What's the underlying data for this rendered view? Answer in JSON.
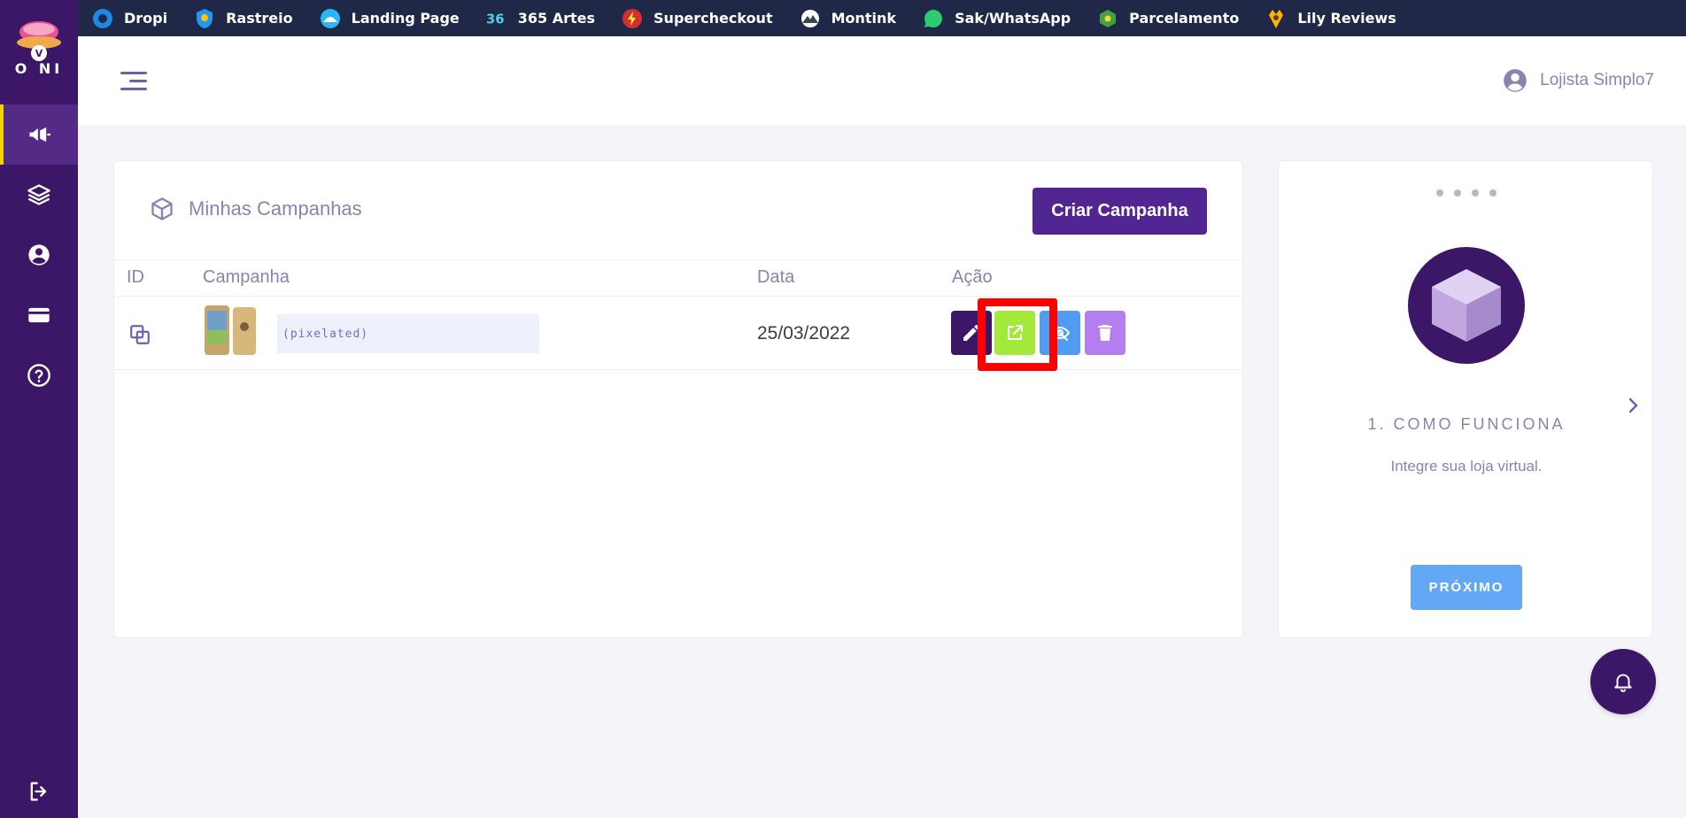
{
  "brand": {
    "logo_text": "O NI",
    "accent": "#3d1767",
    "indicator": "#f2d300"
  },
  "sidebar": {
    "items": [
      {
        "name": "campaigns",
        "icon": "megaphone-icon",
        "active": true
      },
      {
        "name": "layers",
        "icon": "layers-icon",
        "active": false
      },
      {
        "name": "account",
        "icon": "user-circle-icon",
        "active": false
      },
      {
        "name": "billing",
        "icon": "credit-card-icon",
        "active": false
      },
      {
        "name": "help",
        "icon": "help-circle-icon",
        "active": false
      }
    ],
    "logout_icon": "logout-icon"
  },
  "topbar": {
    "links": [
      {
        "label": "Dropi",
        "icon": "dropi-icon"
      },
      {
        "label": "Rastreio",
        "icon": "rastreio-icon"
      },
      {
        "label": "Landing Page",
        "icon": "landing-page-icon"
      },
      {
        "label": "365 Artes",
        "icon": "365-artes-icon"
      },
      {
        "label": "Supercheckout",
        "icon": "supercheckout-icon"
      },
      {
        "label": "Montink",
        "icon": "montink-icon"
      },
      {
        "label": "Sak/WhatsApp",
        "icon": "whatsapp-icon"
      },
      {
        "label": "Parcelamento",
        "icon": "parcelamento-icon"
      },
      {
        "label": "Lily Reviews",
        "icon": "lily-reviews-icon"
      }
    ]
  },
  "header": {
    "user_name": "Lojista Simplo7"
  },
  "campaigns": {
    "title": "Minhas Campanhas",
    "create_label": "Criar Campanha",
    "columns": {
      "id": "ID",
      "campaign": "Campanha",
      "date": "Data",
      "action": "Ação"
    },
    "rows": [
      {
        "name": "(pixelated)",
        "date": "25/03/2022"
      }
    ]
  },
  "tutorial": {
    "step_title": "1. COMO FUNCIONA",
    "description": "Integre sua loja virtual.",
    "next_label": "PRÓXIMO",
    "slides": 4
  }
}
